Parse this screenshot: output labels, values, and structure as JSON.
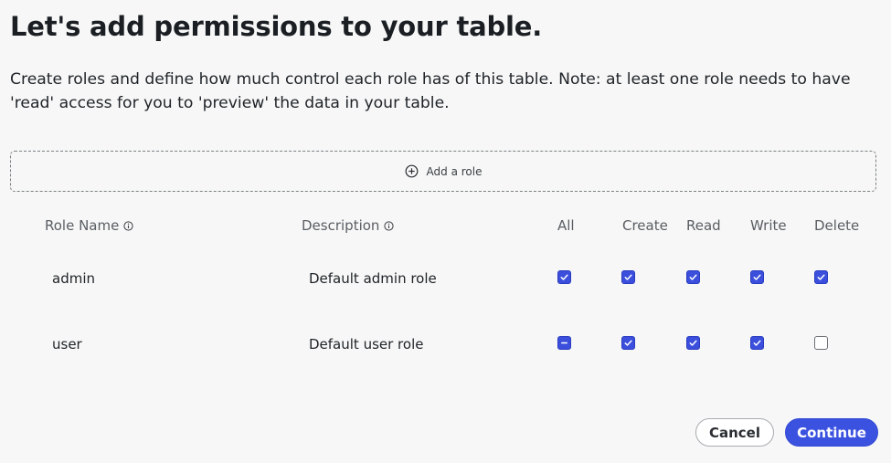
{
  "page": {
    "title": "Let's add permissions to your table.",
    "description": "Create roles and define how much control each role has of this table. Note: at least one role needs to have 'read' access for you to 'preview' the data in your table."
  },
  "add_role": {
    "label": "Add a role",
    "icon": "plus-circle-icon"
  },
  "table": {
    "headers": {
      "role_name": "Role Name",
      "description": "Description",
      "all": "All",
      "create": "Create",
      "read": "Read",
      "write": "Write",
      "delete": "Delete"
    },
    "rows": [
      {
        "role": "admin",
        "description": "Default admin role",
        "all": "checked",
        "create": "checked",
        "read": "checked",
        "write": "checked",
        "delete": "checked"
      },
      {
        "role": "user",
        "description": "Default user role",
        "all": "indeterminate",
        "create": "checked",
        "read": "checked",
        "write": "checked",
        "delete": "unchecked"
      }
    ]
  },
  "actions": {
    "cancel": "Cancel",
    "continue": "Continue"
  },
  "colors": {
    "accent": "#3b52e0",
    "background": "#f6f7f6"
  }
}
